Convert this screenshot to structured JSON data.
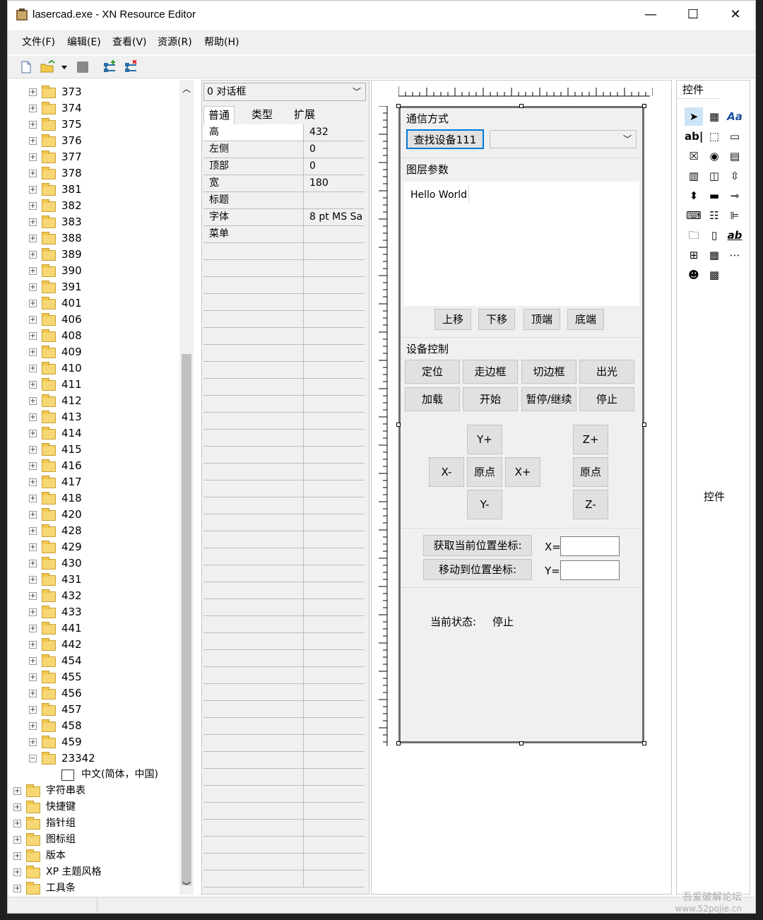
{
  "window": {
    "title": "lasercad.exe - XN Resource Editor",
    "minimize": "—",
    "maximize": "☐",
    "close": "✕"
  },
  "menu": [
    "文件(F)",
    "编辑(E)",
    "查看(V)",
    "资源(R)",
    "帮助(H)"
  ],
  "toolbar_icons": [
    "new-file-icon",
    "open-folder-icon",
    "dropdown-arrow-icon",
    "save-icon",
    "add-resource-icon",
    "delete-resource-icon"
  ],
  "tree": {
    "nodes": [
      "373",
      "374",
      "375",
      "376",
      "377",
      "378",
      "381",
      "382",
      "383",
      "388",
      "389",
      "390",
      "391",
      "401",
      "406",
      "408",
      "409",
      "410",
      "411",
      "412",
      "413",
      "414",
      "415",
      "416",
      "417",
      "418",
      "420",
      "428",
      "429",
      "430",
      "431",
      "432",
      "433",
      "441",
      "442",
      "454",
      "455",
      "456",
      "457",
      "458",
      "459"
    ],
    "expanded_node": "23342",
    "child": "中文(简体，中国)",
    "groups": [
      "字符串表",
      "快捷键",
      "指针组",
      "图标组",
      "版本",
      "XP 主题风格",
      "工具条"
    ]
  },
  "props": {
    "selector": "0 对话框",
    "tabs": [
      "普通",
      "类型",
      "扩展"
    ],
    "rows": [
      {
        "name": "高",
        "value": "432"
      },
      {
        "name": "左侧",
        "value": "0"
      },
      {
        "name": "顶部",
        "value": "0"
      },
      {
        "name": "宽",
        "value": "180"
      },
      {
        "name": "标题",
        "value": ""
      },
      {
        "name": "字体",
        "value": "8 pt MS Sa"
      },
      {
        "name": "菜单",
        "value": ""
      }
    ]
  },
  "dialog": {
    "comm_group": "通信方式",
    "find_btn": "查找设备111",
    "layer_group": "图层参数",
    "list_item": "Hello World",
    "layer_btns": [
      "上移",
      "下移",
      "顶端",
      "底端"
    ],
    "device_group": "设备控制",
    "device_btns": [
      "定位",
      "走边框",
      "切边框",
      "出光",
      "加载",
      "开始",
      "暂停/继续",
      "停止"
    ],
    "jog": {
      "y_plus": "Y+",
      "x_minus": "X-",
      "origin": "原点",
      "x_plus": "X+",
      "y_minus": "Y-",
      "z_plus": "Z+",
      "z_origin": "原点",
      "z_minus": "Z-"
    },
    "get_pos": "获取当前位置坐标:",
    "move_pos": "移动到位置坐标:",
    "x_label": "X=",
    "y_label": "Y=",
    "status_label": "当前状态:",
    "status_value": "停止"
  },
  "toolbox": {
    "tab": "控件",
    "caption": "控件"
  },
  "watermark": {
    "line1": "吾爱破解论坛",
    "line2": "www.52pojie.cn"
  }
}
